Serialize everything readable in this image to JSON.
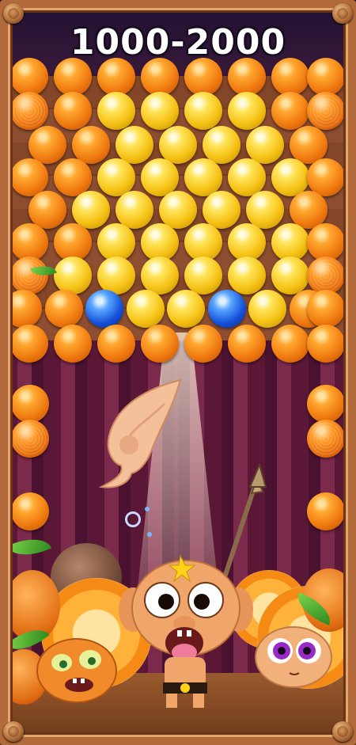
{
  "level": {
    "title": "1000-2000"
  },
  "colors": {
    "orange": "#f07a10",
    "yellow": "#f5c012",
    "blue": "#1450d8"
  },
  "bubble_grid": [
    [
      "orange",
      "orange",
      "orange",
      "orange",
      "orange",
      "orange",
      "orange",
      "orange"
    ],
    [
      "fruit",
      "orange",
      "yellow",
      "yellow",
      "yellow",
      "yellow",
      "orange",
      "fruit"
    ],
    [
      "orange",
      "orange",
      "yellow",
      "yellow",
      "yellow",
      "yellow",
      "orange"
    ],
    [
      "orange",
      "orange",
      "yellow",
      "yellow",
      "yellow",
      "yellow",
      "yellow",
      "orange"
    ],
    [
      "orange",
      "yellow",
      "yellow",
      "yellow",
      "yellow",
      "yellow",
      "orange"
    ],
    [
      "orange",
      "orange",
      "yellow",
      "yellow",
      "yellow",
      "yellow",
      "yellow",
      "orange"
    ],
    [
      "fruit",
      "yellow",
      "yellow",
      "yellow",
      "yellow",
      "yellow",
      "yellow",
      "fruit"
    ],
    [
      "orange",
      "orange",
      "blue",
      "yellow",
      "yellow",
      "blue",
      "yellow",
      "orange",
      "orange"
    ],
    [
      "orange",
      "orange",
      "orange",
      "orange",
      "orange",
      "orange",
      "orange",
      "orange"
    ]
  ],
  "side_bubbles": [
    "orange",
    "fruit",
    "orange"
  ],
  "icons": {
    "shooter": "conch-shell-icon",
    "aim": "aim-reticle-icon",
    "hero": "monkey-character",
    "left_critter": "orange-critter",
    "right_critter": "purple-eyed-critter",
    "weapon": "spear-icon"
  }
}
